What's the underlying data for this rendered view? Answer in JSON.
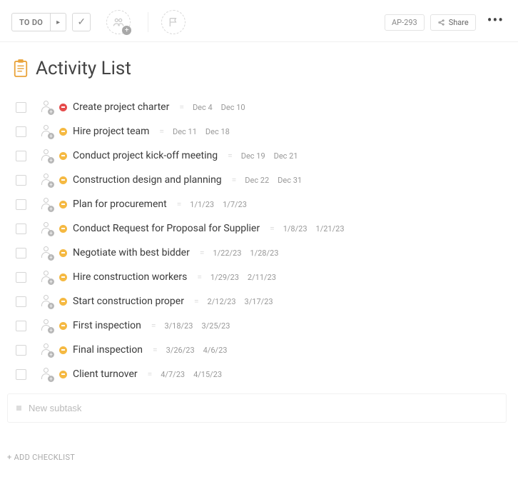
{
  "toolbar": {
    "status_label": "TO DO",
    "task_id": "AP-293",
    "share_label": "Share"
  },
  "title": "Activity List",
  "tasks": [
    {
      "priority": "high",
      "name": "Create project charter",
      "date1": "Dec 4",
      "date2": "Dec 10"
    },
    {
      "priority": "med",
      "name": "Hire project team",
      "date1": "Dec 11",
      "date2": "Dec 18"
    },
    {
      "priority": "med",
      "name": "Conduct project kick-off meeting",
      "date1": "Dec 19",
      "date2": "Dec 21"
    },
    {
      "priority": "med",
      "name": "Construction design and planning",
      "date1": "Dec 22",
      "date2": "Dec 31"
    },
    {
      "priority": "med",
      "name": "Plan for procurement",
      "date1": "1/1/23",
      "date2": "1/7/23"
    },
    {
      "priority": "med",
      "name": "Conduct Request for Proposal for Supplier",
      "date1": "1/8/23",
      "date2": "1/21/23"
    },
    {
      "priority": "med",
      "name": "Negotiate with best bidder",
      "date1": "1/22/23",
      "date2": "1/28/23"
    },
    {
      "priority": "med",
      "name": "Hire construction workers",
      "date1": "1/29/23",
      "date2": "2/11/23"
    },
    {
      "priority": "med",
      "name": "Start construction proper",
      "date1": "2/12/23",
      "date2": "3/17/23"
    },
    {
      "priority": "med",
      "name": "First inspection",
      "date1": "3/18/23",
      "date2": "3/25/23"
    },
    {
      "priority": "med",
      "name": "Final inspection",
      "date1": "3/26/23",
      "date2": "4/6/23"
    },
    {
      "priority": "med",
      "name": "Client turnover",
      "date1": "4/7/23",
      "date2": "4/15/23"
    }
  ],
  "new_subtask_placeholder": "New subtask",
  "add_checklist_label": "+ ADD CHECKLIST"
}
